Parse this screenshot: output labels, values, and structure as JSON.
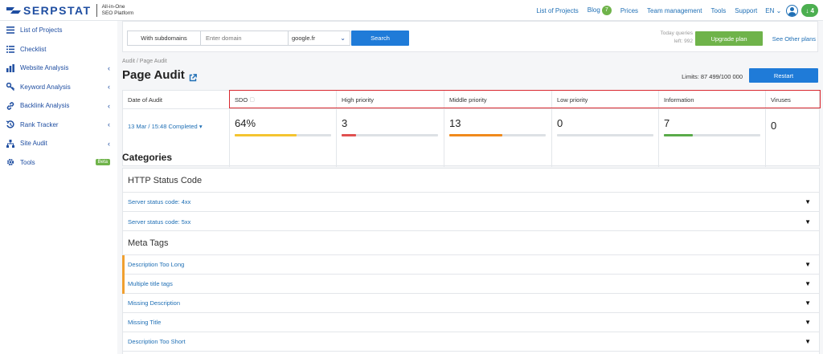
{
  "brand": {
    "name": "SERPSTAT",
    "tagline_line1": "All-in-One",
    "tagline_line2": "SEO Platform",
    "color": "#1f4ea1"
  },
  "topnav": {
    "list_of_projects": "List of Projects",
    "blog": "Blog",
    "blog_badge": "7",
    "prices": "Prices",
    "team_management": "Team management",
    "tools": "Tools",
    "support": "Support",
    "language": "EN",
    "notifications": "4"
  },
  "sidebar": {
    "items": [
      {
        "label": "List of Projects",
        "icon": "list-icon"
      },
      {
        "label": "Checklist",
        "icon": "checklist-icon"
      },
      {
        "label": "Website Analysis",
        "icon": "chart-icon"
      },
      {
        "label": "Keyword Analysis",
        "icon": "key-icon"
      },
      {
        "label": "Backlink Analysis",
        "icon": "link-icon"
      },
      {
        "label": "Rank Tracker",
        "icon": "rank-icon"
      },
      {
        "label": "Site Audit",
        "icon": "sitemap-icon"
      },
      {
        "label": "Tools",
        "icon": "gear-icon",
        "badge": "Beta"
      }
    ]
  },
  "search": {
    "subdomains": "With subdomains",
    "domain_placeholder": "Enter domain",
    "search_engine": "google.fr",
    "button": "Search",
    "queries_line1": "Today queries",
    "queries_line2": "left: 992",
    "upgrade": "Upgrade plan",
    "other_plans": "See Other plans"
  },
  "breadcrumb": "Audit / Page Audit",
  "page_title": "Page Audit",
  "limits": "Limits: 87 499/100 000",
  "restart": "Restart",
  "stats": {
    "date_header": "Date of Audit",
    "date_value": "13 Mar / 15:48 Completed",
    "columns": [
      {
        "label": "SDO",
        "value": "64%",
        "fill": 0.64,
        "color": "#f4c430"
      },
      {
        "label": "High priority",
        "value": "3",
        "fill": 0.15,
        "color": "#e05050"
      },
      {
        "label": "Middle priority",
        "value": "13",
        "fill": 0.55,
        "color": "#f08a1c"
      },
      {
        "label": "Low priority",
        "value": "0",
        "fill": 0,
        "color": "#dde1e5"
      },
      {
        "label": "Information",
        "value": "7",
        "fill": 0.3,
        "color": "#5aab4a"
      },
      {
        "label": "Viruses",
        "value": "0"
      }
    ]
  },
  "categories_title": "Categories",
  "http_status": {
    "title": "HTTP Status Code",
    "rows": [
      "Server status code: 4xx",
      "Server status code: 5xx"
    ]
  },
  "meta_tags": {
    "title": "Meta Tags",
    "rows": [
      "Description Too Long",
      "Multiple title tags",
      "Missing Description",
      "Missing Title",
      "Description Too Short"
    ]
  }
}
